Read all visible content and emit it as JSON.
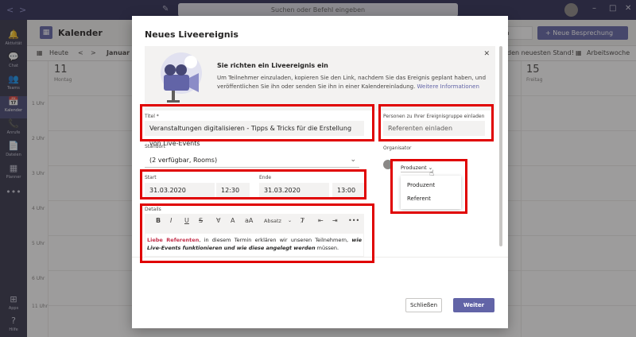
{
  "titlebar": {
    "search_placeholder": "Suchen oder Befehl eingeben",
    "nav_back": "<",
    "nav_forward": ">",
    "win_min": "–",
    "win_max": "□",
    "win_close": "✕"
  },
  "rail": {
    "items": [
      {
        "label": "Aktivität",
        "icon": "bell-icon",
        "glyph": "🔔"
      },
      {
        "label": "Chat",
        "icon": "chat-icon",
        "glyph": "💬"
      },
      {
        "label": "Teams",
        "icon": "teams-icon",
        "glyph": "👥"
      },
      {
        "label": "Kalender",
        "icon": "calendar-icon",
        "glyph": "📅"
      },
      {
        "label": "Anrufe",
        "icon": "phone-icon",
        "glyph": "📞"
      },
      {
        "label": "Dateien",
        "icon": "files-icon",
        "glyph": "📄"
      },
      {
        "label": "Planner",
        "icon": "planner-icon",
        "glyph": "▦"
      },
      {
        "label": "",
        "icon": "more-icon",
        "glyph": "•••"
      }
    ],
    "apps_label": "Apps",
    "help_label": "Hilfe"
  },
  "calendar": {
    "title": "Kalender",
    "join_label": "chen",
    "new_meeting_label": "+ Neue Besprechung",
    "today_label": "Heute",
    "month_label": "Januar 2",
    "jump_label": "den neuesten Stand!",
    "view_label": "Arbeitswoche",
    "day_left": "11",
    "day_left_sub": "Montag",
    "day_right": "15",
    "day_right_sub": "Freitag",
    "hours": [
      "1 Uhr",
      "2 Uhr",
      "3 Uhr",
      "4 Uhr",
      "5 Uhr",
      "6 Uhr",
      "7 Uhr",
      "8 Uhr"
    ],
    "bottom_hour": "11 Uhr"
  },
  "modal": {
    "title": "Neues Liveereignis",
    "banner_title": "Sie richten ein Liveereignis ein",
    "banner_text": "Um Teilnehmer einzuladen, kopieren Sie den Link, nachdem Sie das Ereignis geplant haben, und veröffentlichen Sie ihn oder senden Sie ihn in einer Kalendereinladung.",
    "banner_link": "Weitere Informationen",
    "close_glyph": "✕",
    "title_label": "Titel *",
    "title_value": "Veranstaltungen digitalisieren - Tipps & Tricks für die Erstellung von Live-Events",
    "location_label": "Standort",
    "location_value": "(2 verfügbar, Rooms)",
    "start_label": "Start",
    "start_date": "31.03.2020",
    "start_time": "12:30",
    "end_label": "Ende",
    "end_date": "31.03.2020",
    "end_time": "13:00",
    "details_label": "Details",
    "editor_paragraph_label": "Absatz",
    "editor_text_red": "Liebe Referenten",
    "editor_text_1": ", in diesem Termin erklären wir unseren Teilnehmern, ",
    "editor_text_bi": "wie Live-Events funktionieren und wie diese angelegt werden",
    "editor_text_2": " müssen.",
    "invite_label": "Personen zu Ihrer Ereignisgruppe einladen",
    "invite_placeholder": "Referenten einladen",
    "organizer_label": "Organisator",
    "role_selected": "Produzent",
    "role_options": [
      "Produzent",
      "Referent"
    ],
    "close_button": "Schließen",
    "next_button": "Weiter"
  },
  "colors": {
    "accent": "#6264a7",
    "highlight": "#e00000",
    "titlebar": "#2d2c54",
    "rail": "#33344a"
  }
}
